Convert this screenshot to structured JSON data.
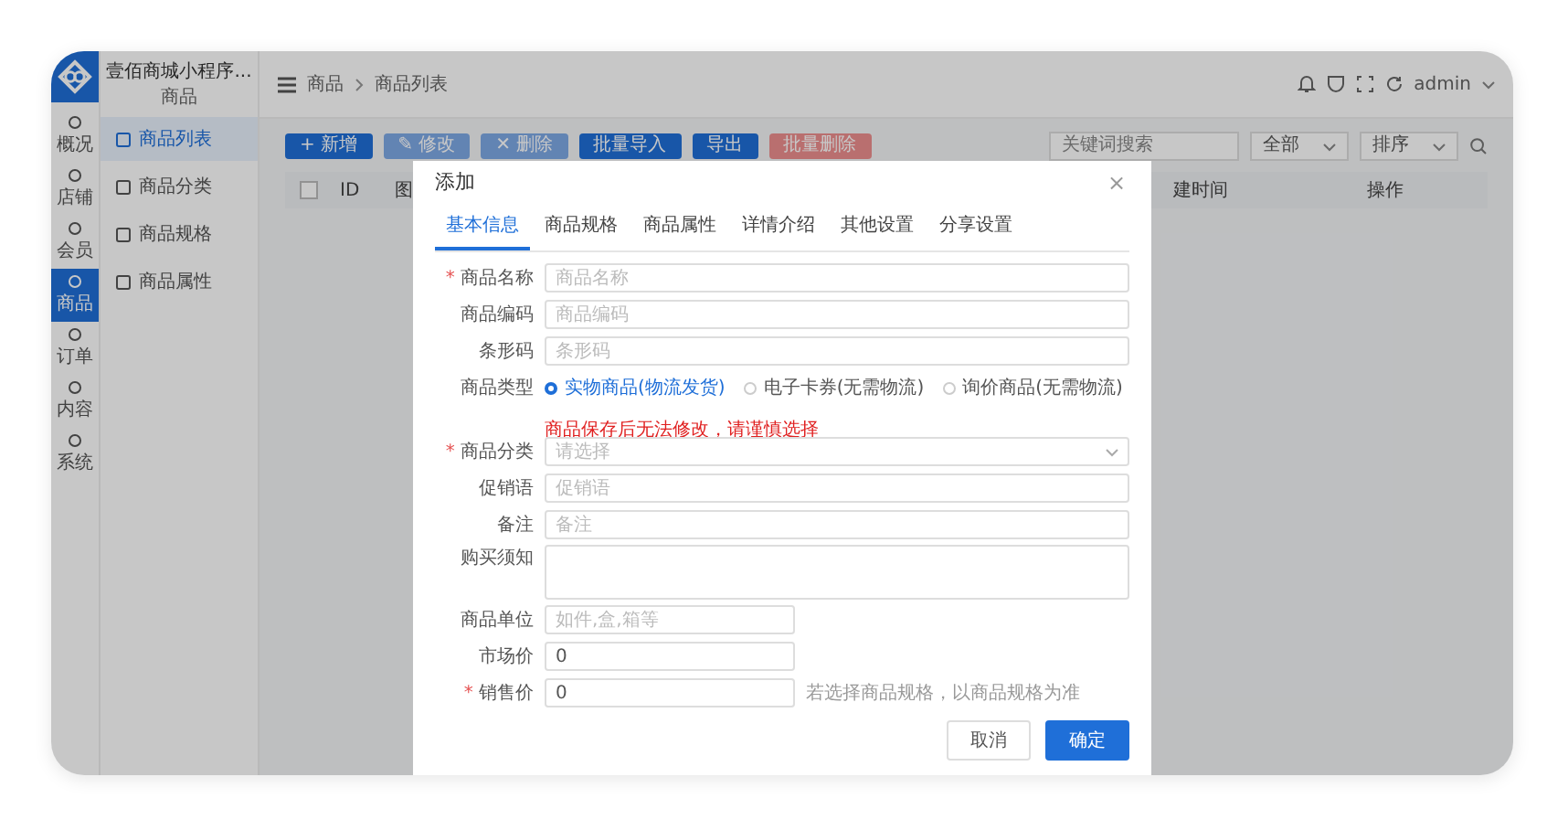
{
  "header": {
    "app_title": "壹佰商城小程序...",
    "app_subtitle": "商品",
    "breadcrumb": [
      "商品",
      "商品列表"
    ],
    "user": "admin"
  },
  "rail": [
    {
      "label": "概况",
      "selected": false
    },
    {
      "label": "店铺",
      "selected": false
    },
    {
      "label": "会员",
      "selected": false
    },
    {
      "label": "商品",
      "selected": true
    },
    {
      "label": "订单",
      "selected": false
    },
    {
      "label": "内容",
      "selected": false
    },
    {
      "label": "系统",
      "selected": false
    }
  ],
  "sidebar": [
    {
      "label": "商品列表",
      "selected": true
    },
    {
      "label": "商品分类",
      "selected": false
    },
    {
      "label": "商品规格",
      "selected": false
    },
    {
      "label": "商品属性",
      "selected": false
    }
  ],
  "toolbar": [
    {
      "label": "+ 新增",
      "kind": "primary",
      "disabled": false
    },
    {
      "label": "✎ 修改",
      "kind": "primary",
      "disabled": true
    },
    {
      "label": "✕ 删除",
      "kind": "primary",
      "disabled": true
    },
    {
      "label": "批量导入",
      "kind": "primary",
      "disabled": false
    },
    {
      "label": "导出",
      "kind": "primary",
      "disabled": false
    },
    {
      "label": "批量删除",
      "kind": "danger",
      "disabled": true
    }
  ],
  "filters": {
    "search_placeholder": "关键词搜索",
    "select_1": "全部",
    "select_2": "排序"
  },
  "table": {
    "select_all_checked": false,
    "columns": [
      "ID",
      "图",
      "建时间",
      "操作"
    ]
  },
  "dialog": {
    "title": "添加",
    "close": "×",
    "required_mark": "*",
    "tabs": [
      {
        "label": "基本信息",
        "selected": true
      },
      {
        "label": "商品规格",
        "selected": false
      },
      {
        "label": "商品属性",
        "selected": false
      },
      {
        "label": "详情介绍",
        "selected": false
      },
      {
        "label": "其他设置",
        "selected": false
      },
      {
        "label": "分享设置",
        "selected": false
      }
    ],
    "fields": [
      {
        "kind": "input",
        "label": "商品名称",
        "required": true,
        "placeholder": "商品名称"
      },
      {
        "kind": "input",
        "label": "商品编码",
        "required": false,
        "placeholder": "商品编码"
      },
      {
        "kind": "input",
        "label": "条形码",
        "required": false,
        "placeholder": "条形码"
      },
      {
        "kind": "radio",
        "label": "商品类型",
        "required": false,
        "options": [
          {
            "label": "实物商品(物流发货)",
            "selected": true
          },
          {
            "label": "电子卡券(无需物流)",
            "selected": false
          },
          {
            "label": "询价商品(无需物流)",
            "selected": false
          }
        ],
        "hint": "商品保存后无法修改，请谨慎选择"
      },
      {
        "kind": "select",
        "label": "商品分类",
        "required": true,
        "placeholder": "请选择"
      },
      {
        "kind": "input",
        "label": "促销语",
        "required": false,
        "placeholder": "促销语"
      },
      {
        "kind": "input",
        "label": "备注",
        "required": false,
        "placeholder": "备注"
      },
      {
        "kind": "textarea",
        "label": "购买须知",
        "required": false
      },
      {
        "kind": "short",
        "label": "商品单位",
        "required": false,
        "placeholder": "如件,盒,箱等"
      },
      {
        "kind": "short",
        "label": "市场价",
        "required": false,
        "value": "0"
      },
      {
        "kind": "short",
        "label": "销售价",
        "required": true,
        "value": "0",
        "note": "若选择商品规格，以商品规格为准"
      }
    ],
    "buttons": [
      {
        "label": "取消",
        "kind": "default"
      },
      {
        "label": "确定",
        "kind": "primary"
      }
    ]
  }
}
